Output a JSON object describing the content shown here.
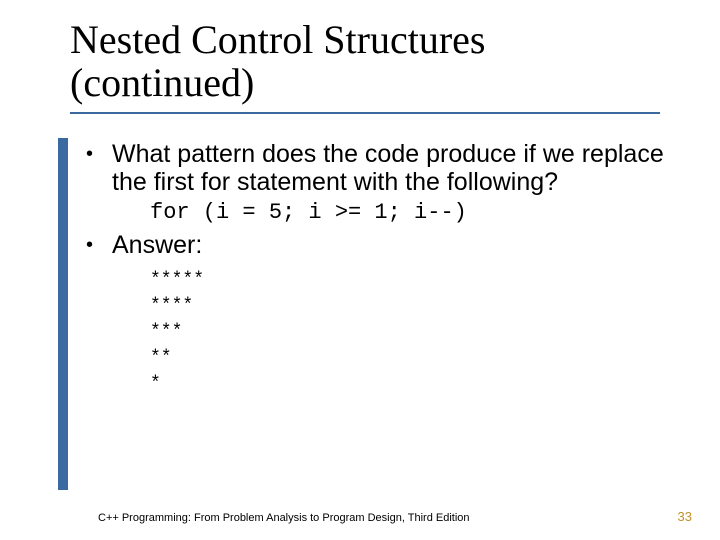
{
  "title": "Nested Control Structures (continued)",
  "bullet1": "What pattern does the code produce if we replace the first for statement with the following?",
  "code": "for (i = 5; i >= 1; i--)",
  "bullet2": "Answer:",
  "output": {
    "l1": "*****",
    "l2": "****",
    "l3": "***",
    "l4": "**",
    "l5": "*"
  },
  "footer": "C++ Programming: From Problem Analysis to Program Design, Third Edition",
  "page": "33"
}
